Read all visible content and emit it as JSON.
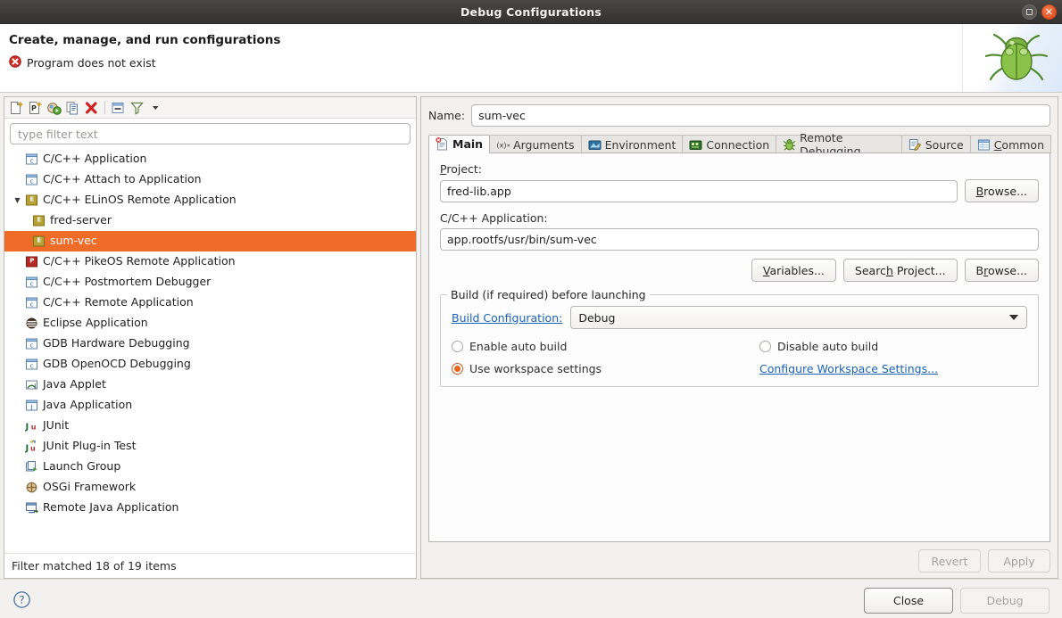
{
  "window": {
    "title": "Debug Configurations",
    "maximize_label": "Maximize",
    "close_label": "Close window"
  },
  "header": {
    "title": "Create, manage, and run configurations",
    "error_message": "Program does not exist",
    "error_icon": "error-circle-icon",
    "banner_icon": "green-bug-icon"
  },
  "left_panel": {
    "toolbar": [
      {
        "name": "new-launch-configuration",
        "icon": "new-config-icon"
      },
      {
        "name": "new-prototype",
        "icon": "new-prototype-icon"
      },
      {
        "name": "new-launch-group",
        "icon": "new-launch-group-icon"
      },
      {
        "name": "duplicate-configuration",
        "icon": "duplicate-icon"
      },
      {
        "name": "delete-configuration",
        "icon": "delete-x-icon"
      },
      {
        "name": "collapse-all",
        "icon": "collapse-all-icon"
      },
      {
        "name": "filter-configurations",
        "icon": "filter-funnel-icon"
      },
      {
        "name": "view-menu",
        "icon": "chevron-down-icon"
      }
    ],
    "filter": {
      "placeholder": "type filter text",
      "value": ""
    },
    "tree": [
      {
        "label": "C/C++ Application",
        "icon": "c-app-icon",
        "indent": 0,
        "twisty": "none",
        "selected": false
      },
      {
        "label": "C/C++ Attach to Application",
        "icon": "c-app-icon",
        "indent": 0,
        "twisty": "none",
        "selected": false
      },
      {
        "label": "C/C++ ELinOS Remote Application",
        "icon": "elinos-icon",
        "indent": 0,
        "twisty": "expanded",
        "selected": false
      },
      {
        "label": "fred-server",
        "icon": "elinos-icon",
        "indent": 1,
        "twisty": "none",
        "selected": false
      },
      {
        "label": "sum-vec",
        "icon": "elinos-icon",
        "indent": 1,
        "twisty": "none",
        "selected": true
      },
      {
        "label": "C/C++ PikeOS Remote Application",
        "icon": "pikeos-icon",
        "indent": 0,
        "twisty": "none",
        "selected": false
      },
      {
        "label": "C/C++ Postmortem Debugger",
        "icon": "c-app-icon",
        "indent": 0,
        "twisty": "none",
        "selected": false
      },
      {
        "label": "C/C++ Remote Application",
        "icon": "c-app-icon",
        "indent": 0,
        "twisty": "none",
        "selected": false
      },
      {
        "label": "Eclipse Application",
        "icon": "eclipse-icon",
        "indent": 0,
        "twisty": "none",
        "selected": false
      },
      {
        "label": "GDB Hardware Debugging",
        "icon": "c-app-icon",
        "indent": 0,
        "twisty": "none",
        "selected": false
      },
      {
        "label": "GDB OpenOCD Debugging",
        "icon": "c-app-icon",
        "indent": 0,
        "twisty": "none",
        "selected": false
      },
      {
        "label": "Java Applet",
        "icon": "java-applet-icon",
        "indent": 0,
        "twisty": "none",
        "selected": false
      },
      {
        "label": "Java Application",
        "icon": "java-app-icon",
        "indent": 0,
        "twisty": "none",
        "selected": false
      },
      {
        "label": "JUnit",
        "icon": "junit-icon",
        "indent": 0,
        "twisty": "none",
        "selected": false
      },
      {
        "label": "JUnit Plug-in Test",
        "icon": "junit-plugin-icon",
        "indent": 0,
        "twisty": "none",
        "selected": false
      },
      {
        "label": "Launch Group",
        "icon": "launch-group-icon",
        "indent": 0,
        "twisty": "none",
        "selected": false
      },
      {
        "label": "OSGi Framework",
        "icon": "osgi-icon",
        "indent": 0,
        "twisty": "none",
        "selected": false
      },
      {
        "label": "Remote Java Application",
        "icon": "remote-java-icon",
        "indent": 0,
        "twisty": "none",
        "selected": false
      }
    ],
    "status": "Filter matched 18 of 19 items"
  },
  "right_panel": {
    "name_label": "Name:",
    "name_value": "sum-vec",
    "tabs": [
      {
        "label": "Main",
        "icon": "main-error-icon",
        "active": true,
        "mnemonic": ""
      },
      {
        "label": "Arguments",
        "icon": "arguments-icon",
        "active": false,
        "mnemonic": ""
      },
      {
        "label": "Environment",
        "icon": "environment-icon",
        "active": false,
        "mnemonic": ""
      },
      {
        "label": "Connection",
        "icon": "connection-icon",
        "active": false,
        "mnemonic": ""
      },
      {
        "label": "Remote Debugging",
        "icon": "remote-debug-bug-icon",
        "active": false,
        "mnemonic": ""
      },
      {
        "label": "Source",
        "icon": "source-icon",
        "active": false,
        "mnemonic": ""
      },
      {
        "label": "Common",
        "icon": "common-icon",
        "active": false,
        "mnemonic": "C"
      }
    ],
    "project": {
      "label": "Project:",
      "label_mnemonic": "P",
      "value": "fred-lib.app",
      "browse_label": "Browse...",
      "browse_mnemonic": "B"
    },
    "application": {
      "label": "C/C++ Application:",
      "value": "app.rootfs/usr/bin/sum-vec",
      "variables_label": "Variables...",
      "variables_mnemonic": "V",
      "search_project_label": "Search Project...",
      "search_project_mnemonic": "h",
      "browse_label": "Browse...",
      "browse_mnemonic": "r"
    },
    "build_group": {
      "legend": "Build (if required) before launching",
      "build_config_label": "Build Configuration:",
      "build_config_value": "Debug",
      "options": [
        {
          "label": "Enable auto build",
          "selected": false
        },
        {
          "label": "Disable auto build",
          "selected": false
        },
        {
          "label": "Use workspace settings",
          "selected": true
        }
      ],
      "configure_link": "Configure Workspace Settings..."
    },
    "revert_label": "Revert",
    "revert_enabled": false,
    "apply_label": "Apply",
    "apply_enabled": false
  },
  "footer": {
    "help_icon": "help-question-icon",
    "close_label": "Close",
    "close_enabled": true,
    "debug_label": "Debug",
    "debug_enabled": false
  },
  "colors": {
    "selection": "#ef6c28",
    "link": "#1a62b8",
    "error": "#d02a2a",
    "titlebar": "#3c3b38"
  }
}
